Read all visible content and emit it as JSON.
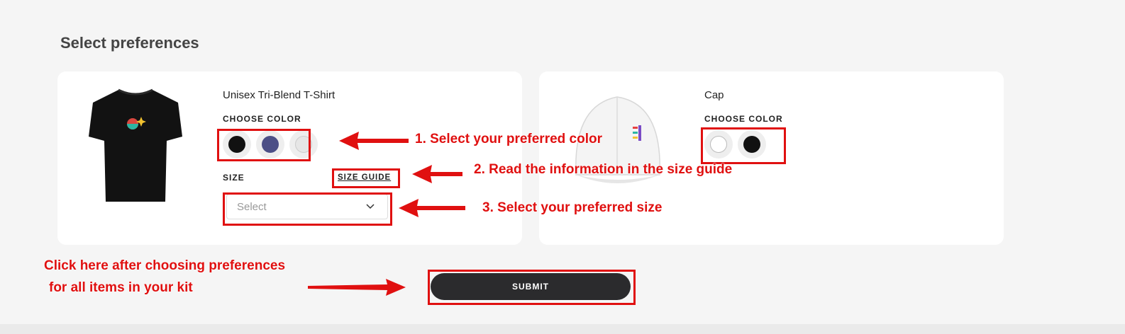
{
  "heading": "Select preferences",
  "products": [
    {
      "name": "Unisex Tri-Blend T-Shirt",
      "color_label": "CHOOSE COLOR",
      "colors": [
        "#111111",
        "#4c4f86",
        "#e6e6e6"
      ],
      "size_label": "SIZE",
      "size_guide": "SIZE GUIDE",
      "size_placeholder": "Select"
    },
    {
      "name": "Cap",
      "color_label": "CHOOSE COLOR",
      "colors": [
        "#ffffff",
        "#111111"
      ]
    }
  ],
  "submit_label": "SUBMIT",
  "annotations": {
    "step1": "1. Select your preferred color",
    "step2": "2. Read the information in the size guide",
    "step3": "3. Select your preferred size",
    "click_line1": "Click here after choosing preferences",
    "click_line2": "for all items in your kit"
  },
  "annotation_color": "#e01010"
}
